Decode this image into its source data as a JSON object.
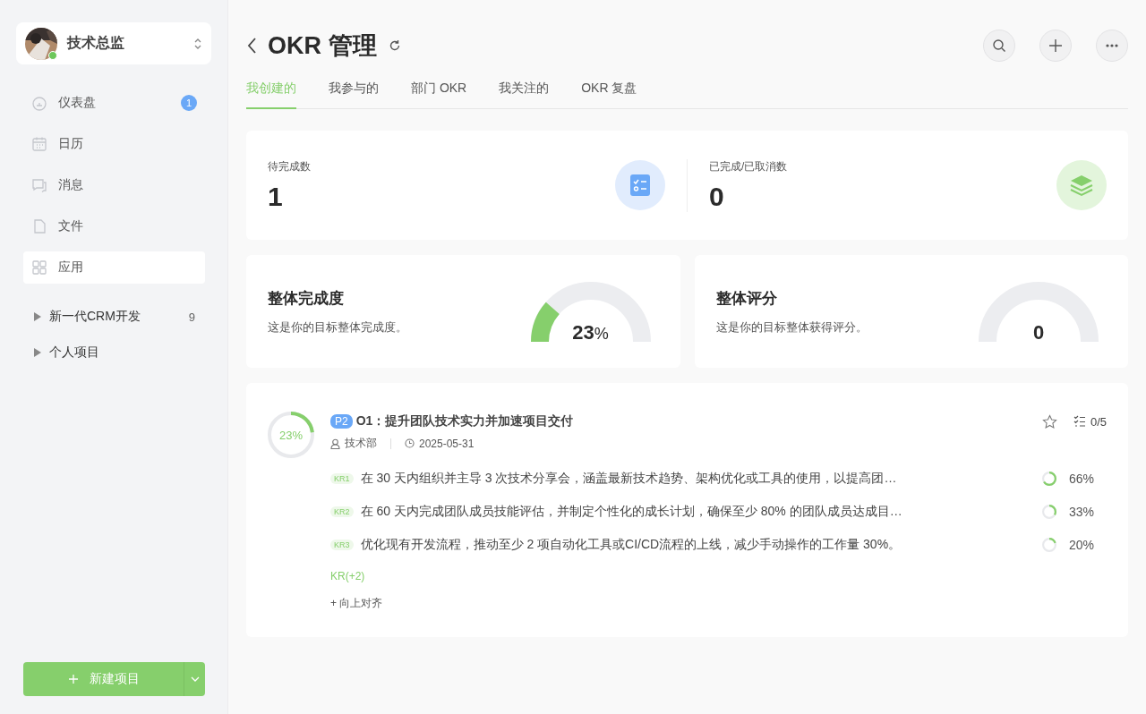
{
  "workspace": {
    "name": "技术总监",
    "online": true
  },
  "nav": [
    {
      "label": "仪表盘",
      "badge": "1",
      "selected": false
    },
    {
      "label": "日历",
      "selected": false
    },
    {
      "label": "消息",
      "selected": false
    },
    {
      "label": "文件",
      "selected": false
    },
    {
      "label": "应用",
      "selected": true
    }
  ],
  "projects": [
    {
      "name": "新一代CRM开发",
      "count": "9",
      "expanded": false
    },
    {
      "name": "个人项目",
      "expanded": false
    }
  ],
  "new_project_button": "新建项目",
  "header": {
    "title": "OKR 管理"
  },
  "tabs": [
    {
      "label": "我创建的",
      "selected": true
    },
    {
      "label": "我参与的",
      "selected": false
    },
    {
      "label": "部门 OKR",
      "selected": false
    },
    {
      "label": "我关注的",
      "selected": false
    },
    {
      "label": "OKR 复盘",
      "selected": false
    }
  ],
  "stats": [
    {
      "label": "待完成数",
      "value": "1",
      "kind": "todo"
    },
    {
      "label": "已完成/已取消数",
      "value": "0",
      "kind": "done"
    }
  ],
  "gauges": [
    {
      "title": "整体完成度",
      "desc": "这是你的目标整体完成度。",
      "value": "23",
      "unit": "%",
      "level": 0.23
    },
    {
      "title": "整体评分",
      "desc": "这是你的目标整体获得评分。",
      "value": "0",
      "level": 0
    }
  ],
  "objective": {
    "progress": "23%",
    "level": 0.23,
    "priority": "P2",
    "title": "O1：提升团队技术实力并加速项目交付",
    "department": "技术部",
    "date": "2025-05-31",
    "starred": false,
    "count": "0/5",
    "key_results": [
      {
        "tag": "KR1",
        "text": "在 30 天内组织并主导 3 次技术分享会，涵盖最新技术趋势、架构优化或工具的使用，以提高团…",
        "level": 0.66,
        "percent": "66%"
      },
      {
        "tag": "KR2",
        "text": "在 60 天内完成团队成员技能评估，并制定个性化的成长计划，确保至少 80% 的团队成员达成目…",
        "level": 0.33,
        "percent": "33%"
      },
      {
        "tag": "KR3",
        "text": "优化现有开发流程，推动至少 2 项自动化工具或CI/CD流程的上线，减少手动操作的工作量 30%。",
        "level": 0.2,
        "percent": "20%"
      }
    ],
    "more_kr": "KR(+2)",
    "align": "+ 向上对齐"
  }
}
